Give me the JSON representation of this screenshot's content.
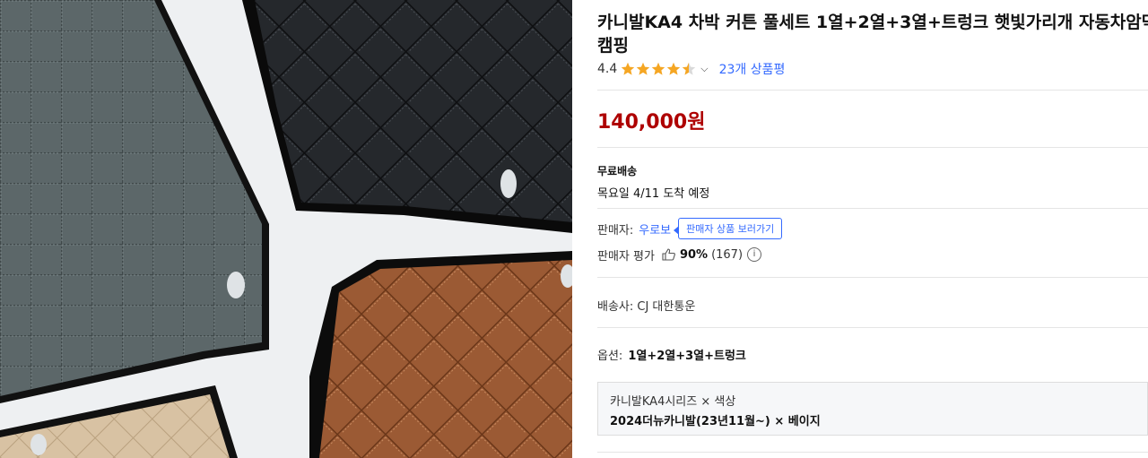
{
  "product": {
    "title": "카니발KA4 차박 커튼 풀세트 1열+2열+3열+트렁크 햇빛가리개 자동차암막 캠핑",
    "rating": "4.4",
    "star_fill": 0.88,
    "review_link": "23개 상품평",
    "price": "140,000원"
  },
  "shipping": {
    "label": "무료배송",
    "date": "목요일 4/11 도착 예정"
  },
  "seller": {
    "label": "판매자:",
    "name": "우로보",
    "tooltip": "판매자 상품 보러가기",
    "rating_label": "판매자 평가",
    "rating_pct": "90%",
    "rating_count": "(167)"
  },
  "carrier": "배송사: CJ 대한통운",
  "option": {
    "label": "옵션:",
    "value": "1열+2열+3열+트렁크"
  },
  "option_box": {
    "line1": "카니발KA4시리즈 × 색상",
    "line2": "2024더뉴카니발(23년11월~) × 베이지"
  },
  "colors": {
    "price": "#ae0000",
    "link": "#346aff",
    "star": "#f5a623"
  },
  "icons": [
    "star-icon",
    "chevron-down-icon",
    "thumbs-up-icon",
    "info-icon"
  ]
}
